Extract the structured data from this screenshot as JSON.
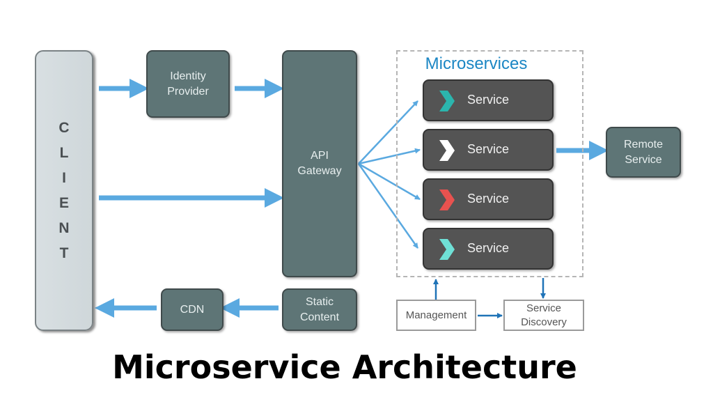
{
  "diagram_title": "Microservice Architecture",
  "client": {
    "letters": [
      "C",
      "L",
      "I",
      "E",
      "N",
      "T"
    ]
  },
  "nodes": {
    "identity_provider": "Identity\nProvider",
    "api_gateway": "API\nGateway",
    "cdn": "CDN",
    "static_content": "Static\nContent",
    "remote_service": "Remote\nService",
    "management": "Management",
    "service_discovery": "Service\nDiscovery"
  },
  "microservices": {
    "title": "Microservices",
    "services": [
      {
        "label": "Service",
        "chevron_color": "#2bb5ad"
      },
      {
        "label": "Service",
        "chevron_color": "#ffffff"
      },
      {
        "label": "Service",
        "chevron_color": "#e8524f"
      },
      {
        "label": "Service",
        "chevron_color": "#6fe0d6"
      }
    ]
  },
  "colors": {
    "arrow": "#5aa9e0",
    "arrow_dark": "#1f73b7",
    "title_blue": "#1b86c4"
  }
}
